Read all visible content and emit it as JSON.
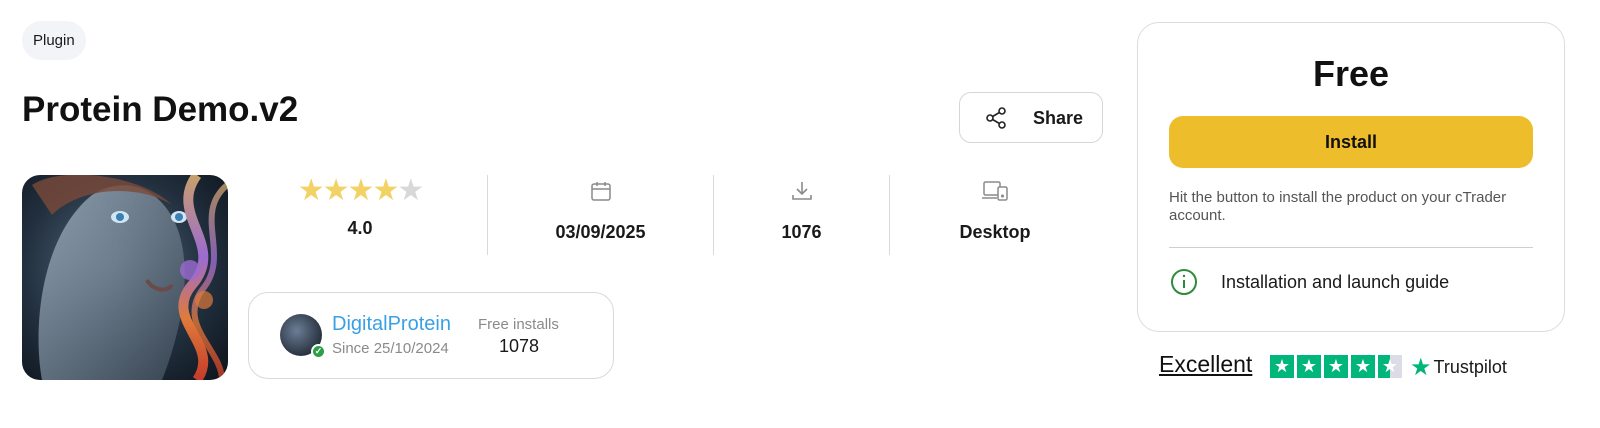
{
  "category_tag": "Plugin",
  "product": {
    "title": "Protein Demo.v2",
    "share_label": "Share"
  },
  "stats": {
    "rating_stars": 4,
    "rating_max": 5,
    "rating": "4.0",
    "date": "03/09/2025",
    "downloads": "1076",
    "platform": "Desktop"
  },
  "author": {
    "name": "DigitalProtein",
    "since": "Since 25/10/2024",
    "free_installs_label": "Free installs",
    "free_installs": "1078"
  },
  "purchase": {
    "price": "Free",
    "install_label": "Install",
    "hint": "Hit the button to install the product on your cTrader account.",
    "guide_label": "Installation and launch guide"
  },
  "trustpilot": {
    "rating_text": "Excellent",
    "stars": 4.5,
    "brand": "Trustpilot"
  },
  "colors": {
    "install_button": "#eebd2c",
    "author_link": "#3aa0e6",
    "trustpilot_green": "#00b67a",
    "star": "#f2d264"
  }
}
